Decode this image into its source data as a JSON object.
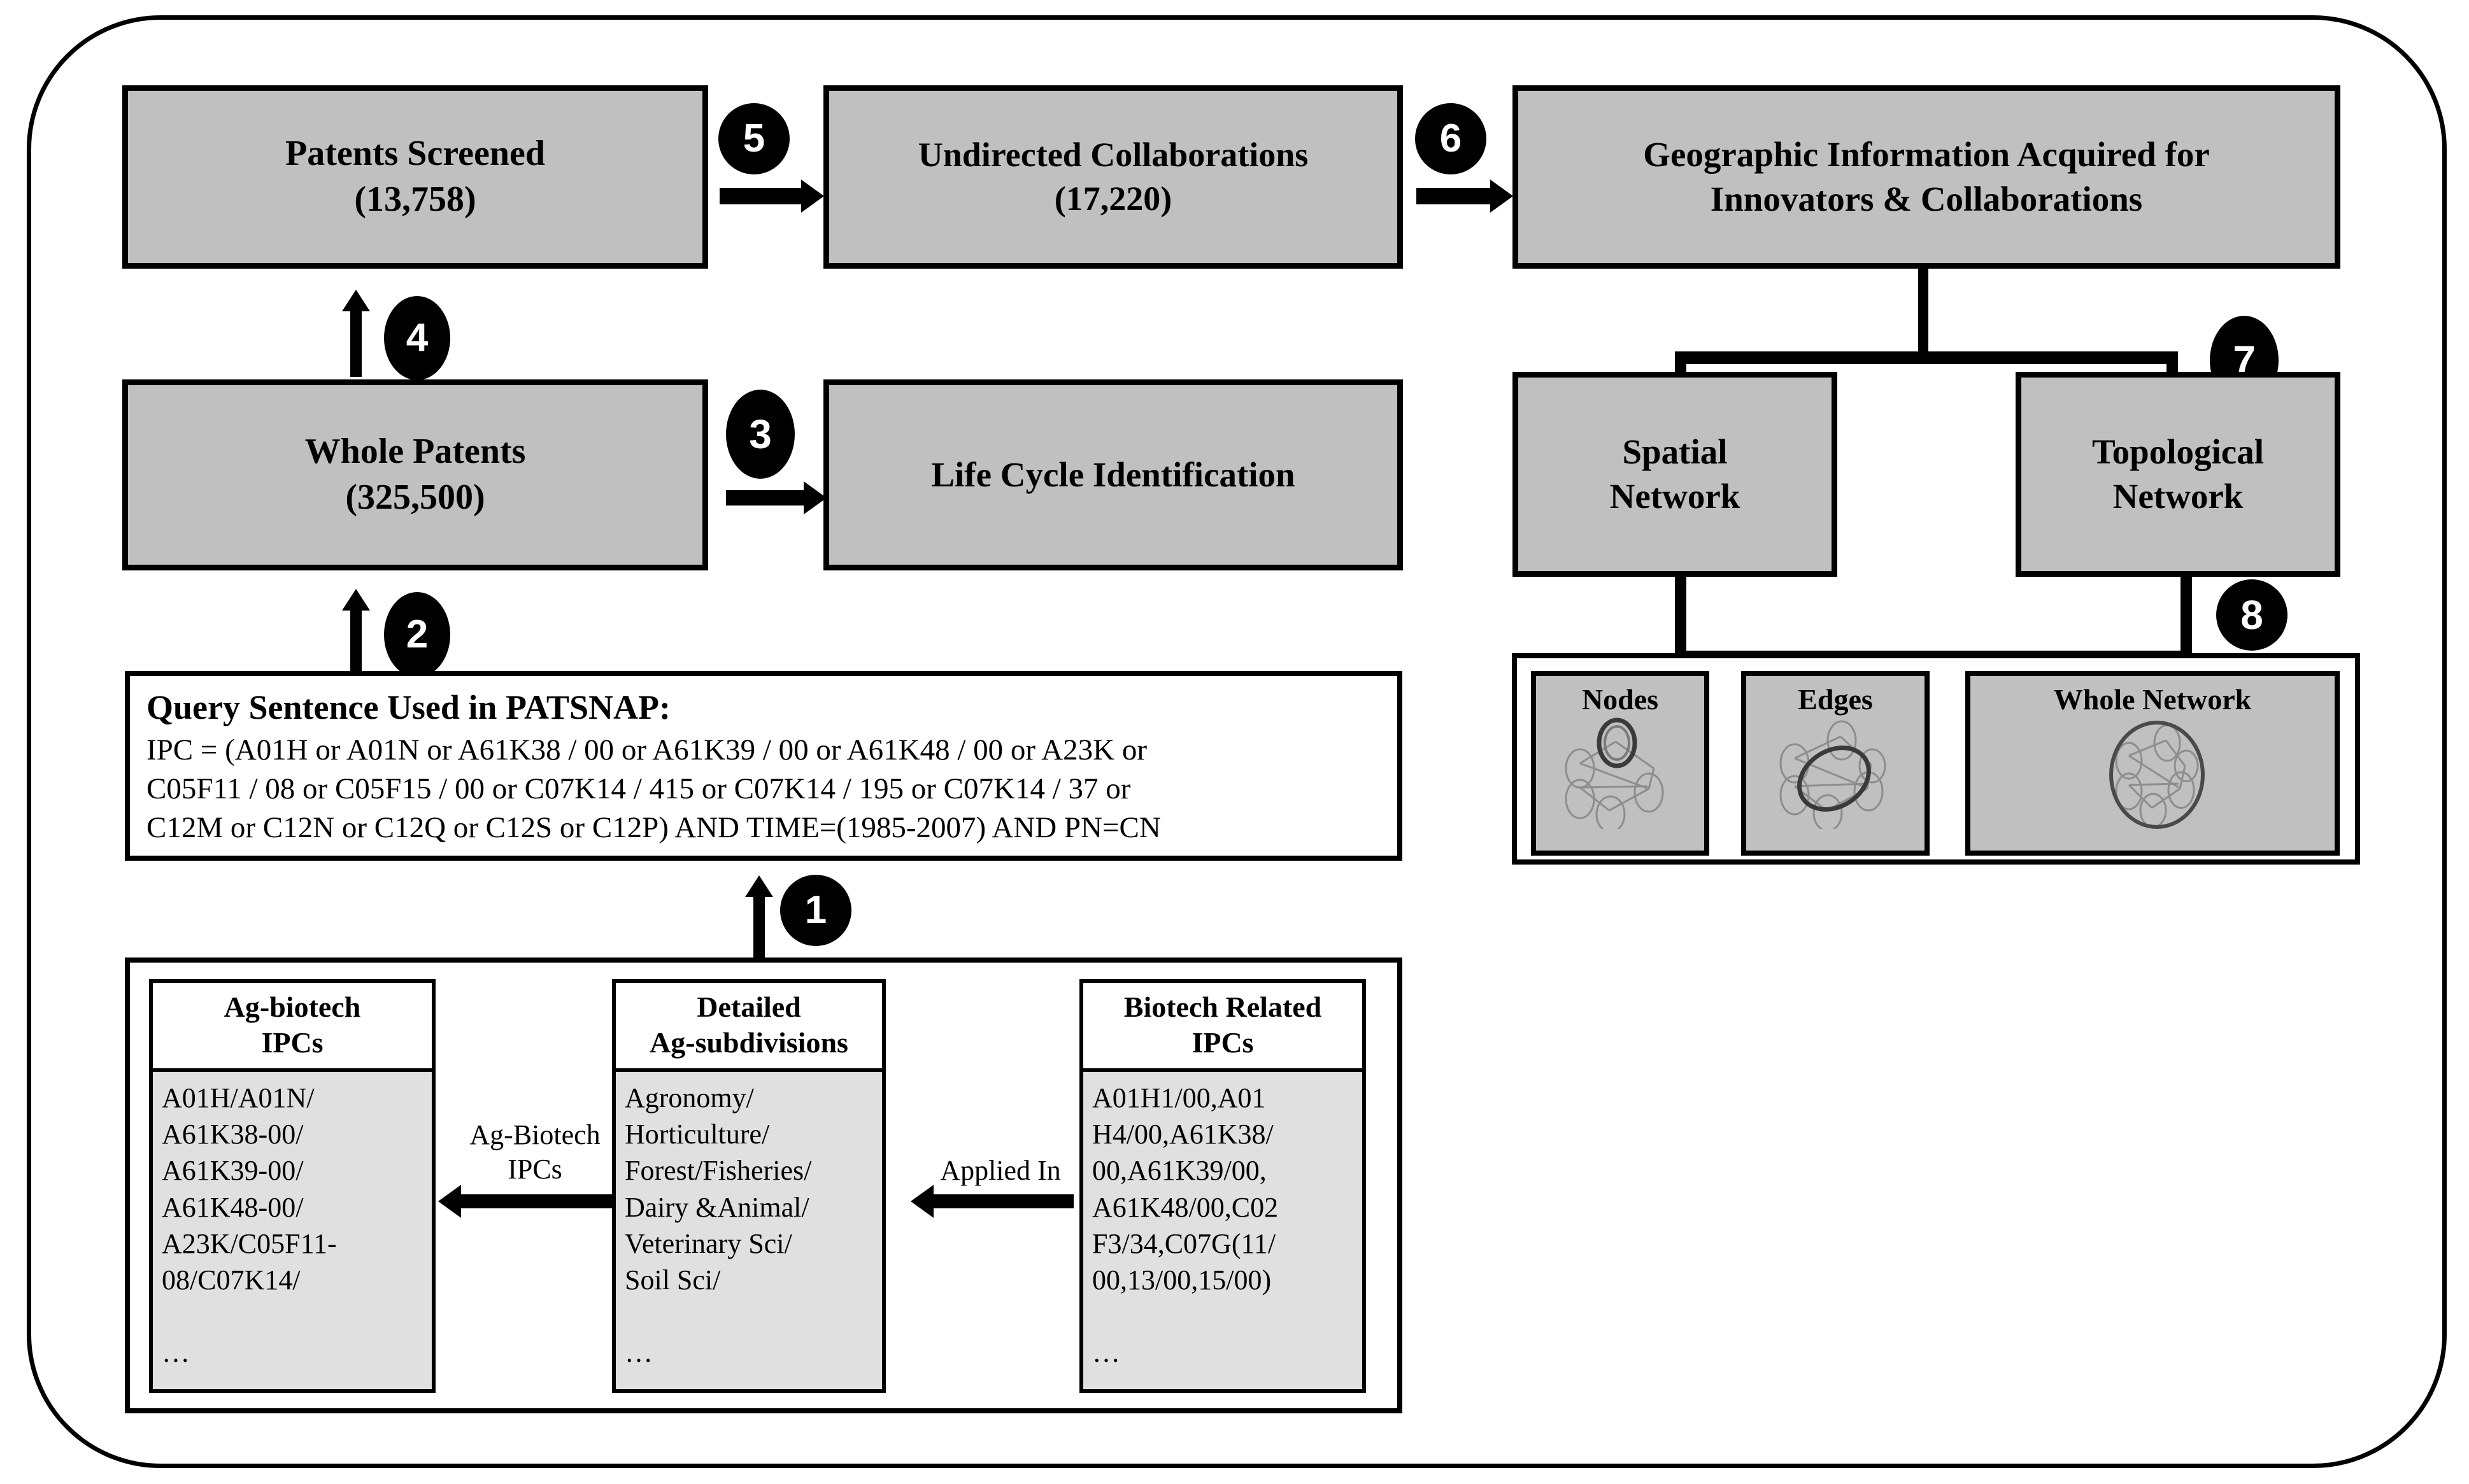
{
  "figure": {
    "type": "flowchart",
    "title": "Patent data collection and network construction workflow"
  },
  "boxes": {
    "patents_screened": {
      "line1": "Patents Screened",
      "line2": "(13,758)"
    },
    "undirected_collaborations": {
      "line1": "Undirected  Collaborations",
      "line2": "(17,220)"
    },
    "geographic_info": {
      "line1": "Geographic Information Acquired for",
      "line2": "Innovators & Collaborations"
    },
    "whole_patents": {
      "line1": "Whole Patents",
      "line2": "(325,500)"
    },
    "life_cycle": {
      "line1": "Life Cycle  Identification"
    },
    "spatial_network": {
      "line1": "Spatial",
      "line2": "Network"
    },
    "topological_network": {
      "line1": "Topological",
      "line2": "Network"
    }
  },
  "query": {
    "title": "Query Sentence Used in PATSNAP:",
    "body": "IPC = (A01H or A01N or A61K38 / 00 or A61K39 / 00 or A61K48 / 00 or A23K or\nC05F11 / 08 or C05F15 / 00 or C07K14 / 415 or C07K14 / 195 or C07K14 / 37 or\nC12M or C12N or C12Q or C12S or C12P) AND TIME=(1985-2007) AND PN=CN"
  },
  "ipc_columns": [
    {
      "header_line1": "Ag-biotech",
      "header_line2": "IPCs",
      "body": "A01H/A01N/\nA61K38-00/\nA61K39-00/\nA61K48-00/\nA23K/C05F11-\n08/C07K14/\n\n…"
    },
    {
      "header_line1": "Detailed",
      "header_line2": "Ag-subdivisions",
      "body": "Agronomy/\nHorticulture/\nForest/Fisheries/\nDairy &Animal/\nVeterinary Sci/\nSoil Sci/\n\n…"
    },
    {
      "header_line1": "Biotech Related",
      "header_line2": "IPCs",
      "body": "A01H1/00,A01\nH4/00,A61K38/\n00,A61K39/00,\nA61K48/00,C02\nF3/34,C07G(11/\n00,13/00,15/00)\n\n…"
    }
  ],
  "flow_labels": {
    "ag_biotech_ipcs_line1": "Ag-Biotech",
    "ag_biotech_ipcs_line2": "IPCs",
    "applied_in": "Applied In"
  },
  "network_cells": [
    {
      "caption": "Nodes",
      "icon": "network-nodes-highlight-icon"
    },
    {
      "caption": "Edges",
      "icon": "network-edges-highlight-icon"
    },
    {
      "caption": "Whole Network",
      "icon": "network-whole-highlight-icon"
    }
  ],
  "step_badges": [
    {
      "number": "1"
    },
    {
      "number": "2"
    },
    {
      "number": "3"
    },
    {
      "number": "4"
    },
    {
      "number": "5"
    },
    {
      "number": "6"
    },
    {
      "number": "7"
    },
    {
      "number": "8"
    }
  ],
  "colors": {
    "box_fill": "#c0c0c0",
    "panel_fill": "#e0e0e0",
    "stroke": "#000000",
    "background": "#ffffff",
    "badge_fill": "#000000",
    "badge_text": "#ffffff"
  }
}
